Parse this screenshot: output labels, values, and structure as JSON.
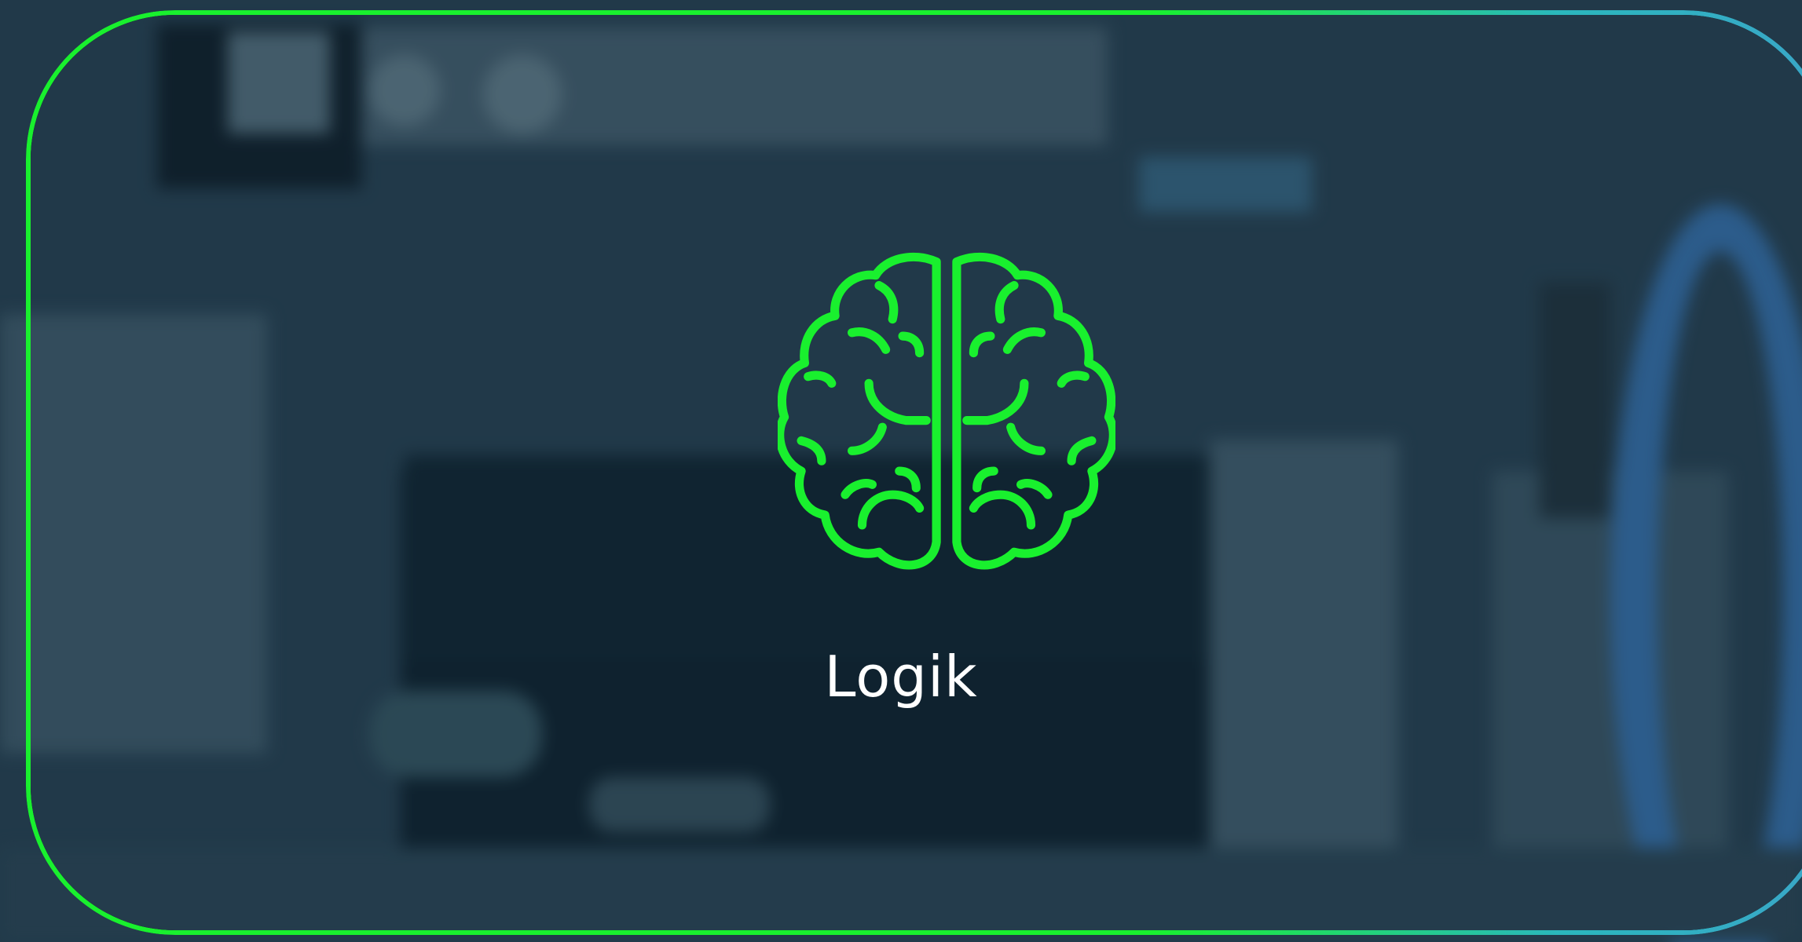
{
  "card": {
    "title": "Logik",
    "icon": "brain-icon",
    "accent_color": "#19f02e",
    "border_gradient_end": "#3aa6c8"
  }
}
